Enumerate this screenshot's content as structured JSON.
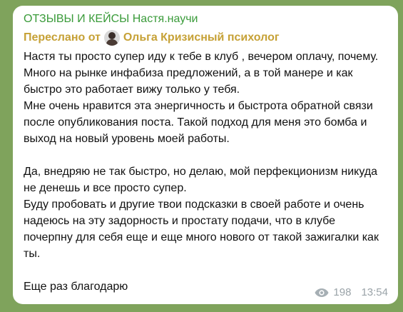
{
  "channel": {
    "title": "ОТЗЫВЫ И КЕЙСЫ Настя.научи"
  },
  "forward": {
    "prefix": "Переслано от",
    "author": "Ольга Кризисный психолог"
  },
  "message": {
    "line1": "Настя ты просто супер иду к тебе в клуб , вечером оплачу, почему.",
    "line2": "Много на рынке инфабиза предложений, а в той манере и как быстро это работает вижу только у тебя.",
    "line3": "Мне очень нравится эта энергичность и быстрота обратной связи после опубликования поста. Такой подход для меня это бомба и выход на новый уровень моей работы.",
    "line4": "Да, внедряю не так быстро, но делаю, мой перфекционизм никуда не денешь и все просто супер.",
    "line5": "Буду пробовать и другие твои подсказки в своей работе и очень надеюсь на эту задорность и простату подачи, что в клубе почерпну для себя еще и еще много нового от такой зажигалки как ты.",
    "line6": "Еще раз благодарю"
  },
  "meta": {
    "views": "198",
    "time": "13:54",
    "views_icon": "eye-icon"
  }
}
